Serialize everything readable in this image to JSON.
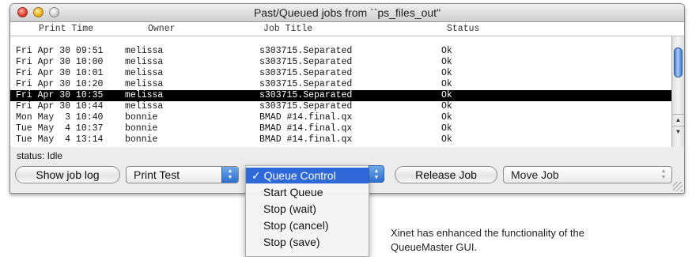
{
  "window": {
    "title": "Past/Queued jobs from ``ps_files_out\""
  },
  "columns": {
    "print_time": "Print Time",
    "owner": "Owner",
    "job_title": "Job Title",
    "status": "Status"
  },
  "rows": [
    {
      "time": "Fri Apr 30 09:51",
      "owner": "melissa",
      "title": "s303715.Separated",
      "status": "Ok"
    },
    {
      "time": "Fri Apr 30 10:00",
      "owner": "melissa",
      "title": "s303715.Separated",
      "status": "Ok"
    },
    {
      "time": "Fri Apr 30 10:01",
      "owner": "melissa",
      "title": "s303715.Separated",
      "status": "Ok"
    },
    {
      "time": "Fri Apr 30 10:20",
      "owner": "melissa",
      "title": "s303715.Separated",
      "status": "Ok"
    },
    {
      "time": "Fri Apr 30 10:35",
      "owner": "melissa",
      "title": "s303715.Separated",
      "status": "Ok"
    },
    {
      "time": "Fri Apr 30 10:44",
      "owner": "melissa",
      "title": "s303715.Separated",
      "status": "Ok"
    },
    {
      "time": "Mon May  3 10:40",
      "owner": "bonnie",
      "title": "BMAD #14.final.qx",
      "status": "Ok"
    },
    {
      "time": "Tue May  4 10:37",
      "owner": "bonnie",
      "title": "BMAD #14.final.qx",
      "status": "Ok"
    },
    {
      "time": "Tue May  4 13:14",
      "owner": "bonnie",
      "title": "BMAD #14.final.qx",
      "status": "Ok"
    }
  ],
  "status_line": "status: Idle",
  "buttons": {
    "show_job_log": "Show job log",
    "release_job": "Release Job"
  },
  "popups": {
    "print_test": "Print Test",
    "move_job": "Move Job"
  },
  "menu": {
    "items": [
      {
        "label": "✓ Queue Control"
      },
      {
        "label": "Start Queue"
      },
      {
        "label": "Stop (wait)"
      },
      {
        "label": "Stop (cancel)"
      },
      {
        "label": "Stop (save)"
      }
    ]
  },
  "caption": {
    "line1": "Xinet has enhanced the functionality of the",
    "line2": "QueueMaster GUI."
  },
  "colors": {
    "selection": "#000000",
    "menu_highlight": "#2f69d8",
    "scroll_thumb": "#3e78c9"
  }
}
